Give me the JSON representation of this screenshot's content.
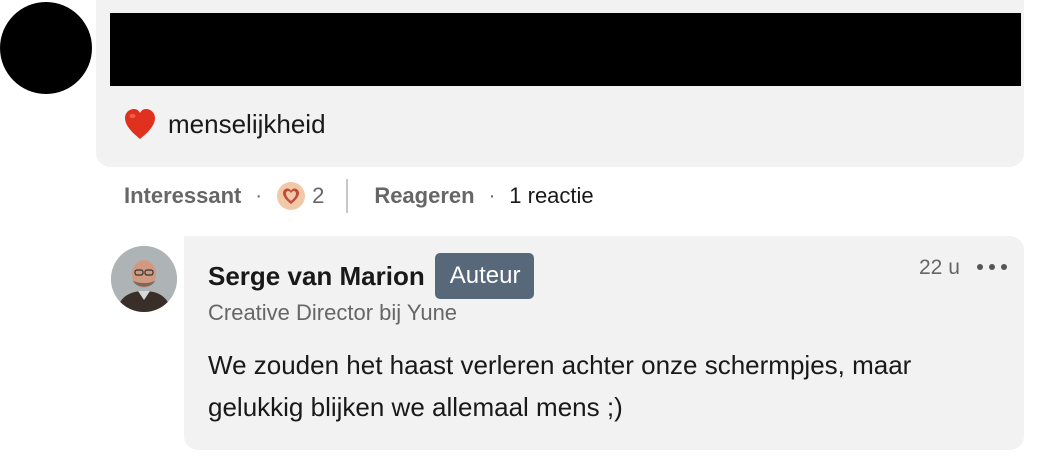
{
  "comment": {
    "text": "menselijkheid",
    "heart_emoji_icon": "red-heart-icon"
  },
  "actions": {
    "like_label": "Interessant",
    "reaction_icon": "heart-reaction-icon",
    "reaction_count": "2",
    "reply_label": "Reageren",
    "reply_count": "1 reactie",
    "separator": "·"
  },
  "reply": {
    "author_name": "Serge van Marion",
    "author_badge": "Auteur",
    "headline": "Creative Director bij Yune",
    "time": "22 u",
    "text": "We zouden het haast verleren achter onze schermpjes, maar gelukkig blijken we allemaal mens ;)"
  },
  "colors": {
    "bubble": "#f2f2f2",
    "badge": "#56687a",
    "muted_text": "#666666",
    "heart": "#e0301e"
  }
}
